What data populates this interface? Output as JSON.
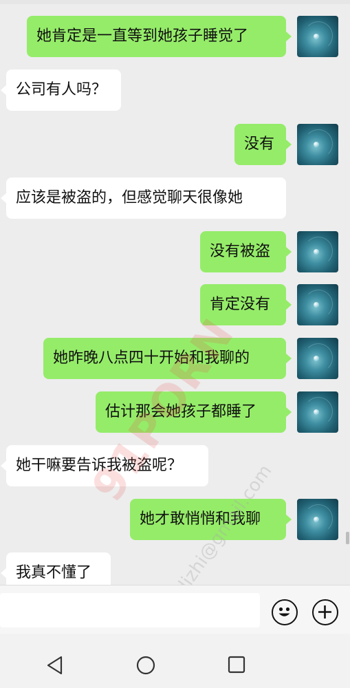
{
  "messages": [
    {
      "side": "out",
      "text": "她肯定是一直等到她孩子睡觉了"
    },
    {
      "side": "in",
      "text": "公司有人吗？"
    },
    {
      "side": "out",
      "text": "没有"
    },
    {
      "side": "in",
      "text": "应该是被盗的，但感觉聊天很像她"
    },
    {
      "side": "out",
      "text": "没有被盗"
    },
    {
      "side": "out",
      "text": "肯定没有"
    },
    {
      "side": "out",
      "text": "她昨晚八点四十开始和我聊的"
    },
    {
      "side": "out",
      "text": "估计那会她孩子都睡了"
    },
    {
      "side": "in",
      "text": "她干嘛要告诉我被盗呢？"
    },
    {
      "side": "out",
      "text": "她才敢悄悄和我聊"
    },
    {
      "side": "in",
      "text": "我真不懂了"
    }
  ],
  "watermark": {
    "brand": "91PORN",
    "email": "91dizhi@gmail.com"
  },
  "composer": {
    "input_value": ""
  },
  "icons": {
    "emoji": "emoji-smile-icon",
    "more": "plus-circle-icon",
    "back": "nav-back-icon",
    "home": "nav-home-icon",
    "recent": "nav-recent-icon"
  },
  "colors": {
    "outgoing_bubble": "#95ec69",
    "incoming_bubble": "#ffffff",
    "background": "#ededed"
  }
}
